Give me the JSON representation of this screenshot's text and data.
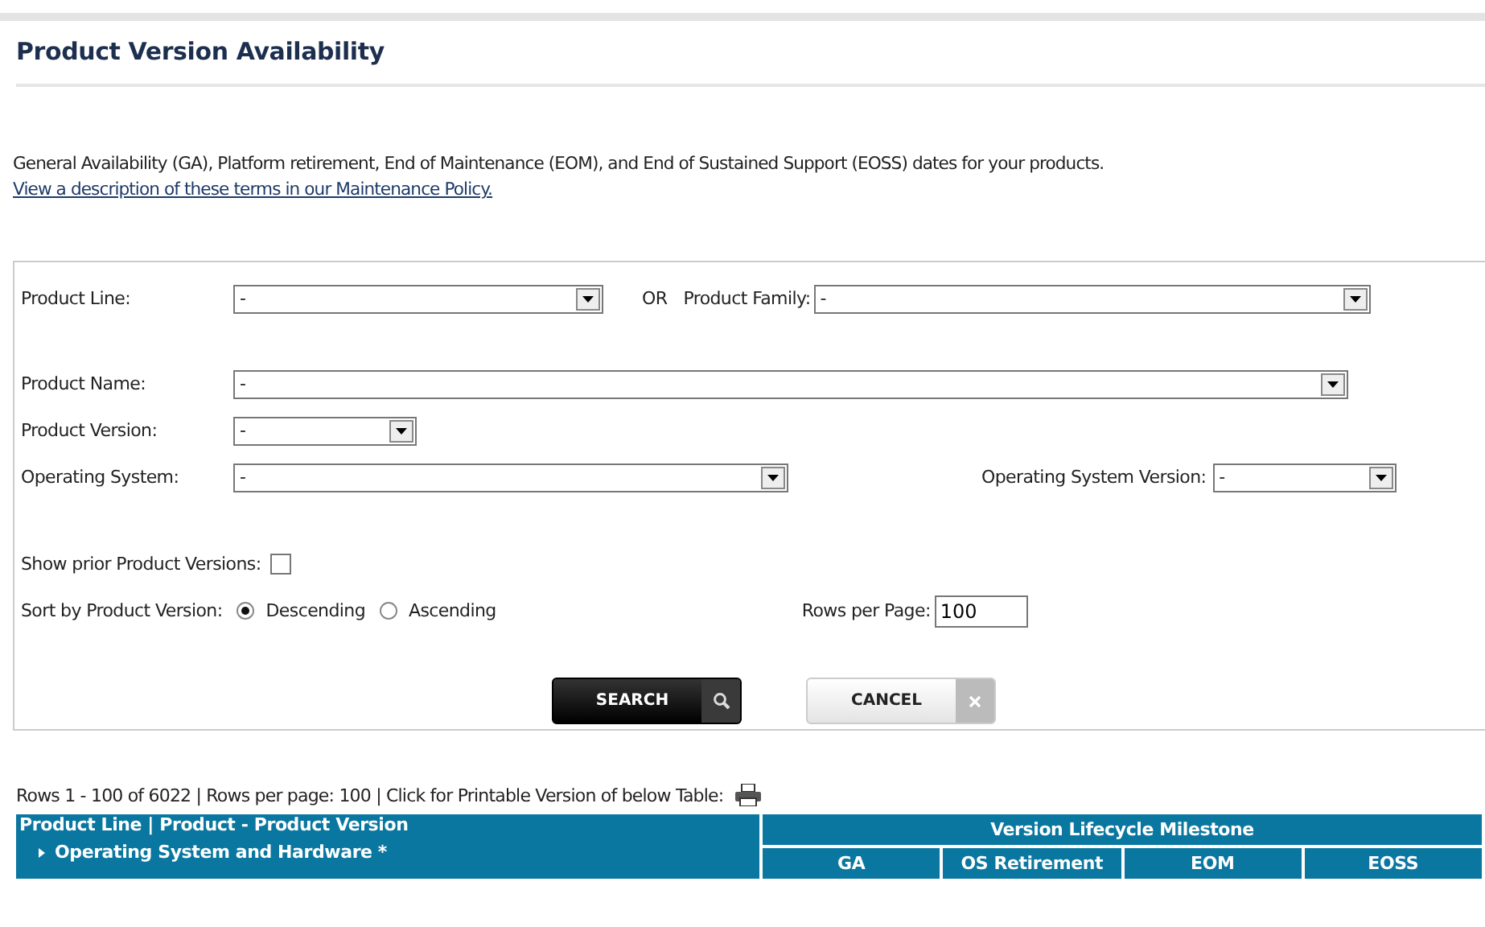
{
  "title": "Product Version Availability",
  "description": "General Availability (GA), Platform retirement, End of Maintenance (EOM), and End of Sustained Support (EOSS) dates for your products.",
  "policy_link": "View a description of these terms in our Maintenance Policy.",
  "form": {
    "product_line": {
      "label": "Product Line:",
      "value": "-"
    },
    "or_label": "OR",
    "product_family": {
      "label": "Product Family:",
      "value": "-"
    },
    "product_name": {
      "label": "Product Name:",
      "value": "-"
    },
    "product_version": {
      "label": "Product Version:",
      "value": "-"
    },
    "operating_system": {
      "label": "Operating System:",
      "value": "-"
    },
    "os_version": {
      "label": "Operating System Version:",
      "value": "-"
    },
    "show_prior": {
      "label": "Show prior Product Versions:",
      "checked": false
    },
    "sort": {
      "label": "Sort by Product Version:",
      "options": [
        {
          "label": "Descending",
          "selected": true
        },
        {
          "label": "Ascending",
          "selected": false
        }
      ]
    },
    "rows_per_page": {
      "label": "Rows per Page:",
      "value": "100"
    },
    "buttons": [
      {
        "label": "SEARCH",
        "kind": "search"
      },
      {
        "label": "CANCEL",
        "kind": "cancel"
      }
    ]
  },
  "status": "Rows 1 - 100 of 6022 | Rows per page: 100 | Click for Printable Version of below Table:",
  "table": {
    "heading": "Product Line | Product - Product Version",
    "subheading": "Operating System and Hardware *",
    "group": "Version Lifecycle Milestone",
    "columns": [
      "GA",
      "OS Retirement",
      "EOM",
      "EOSS"
    ]
  }
}
